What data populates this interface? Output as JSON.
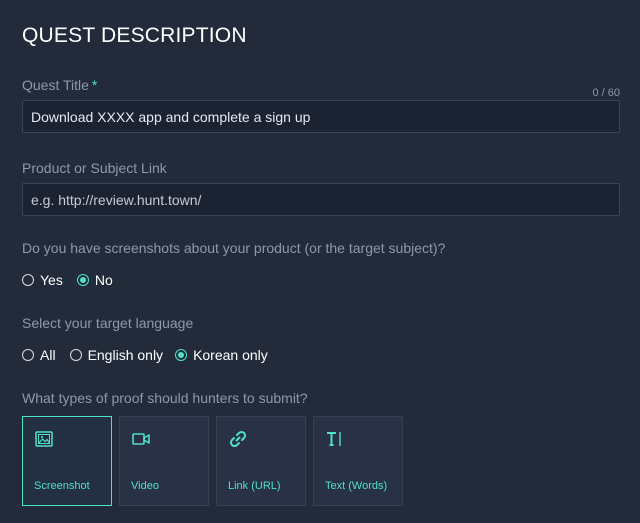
{
  "form": {
    "title": "QUEST DESCRIPTION",
    "quest_title": {
      "label": "Quest Title",
      "required_mark": "*",
      "counter": "0 / 60",
      "value": "Download XXXX app and complete a sign up"
    },
    "product_link": {
      "label": "Product or Subject Link",
      "placeholder": "e.g. http://review.hunt.town/"
    },
    "screenshots_question": {
      "label": "Do you have screenshots about your product (or the target subject)?",
      "options": [
        {
          "label": "Yes",
          "checked": false
        },
        {
          "label": "No",
          "checked": true
        }
      ]
    },
    "language": {
      "label": "Select your target language",
      "options": [
        {
          "label": "All",
          "checked": false
        },
        {
          "label": "English only",
          "checked": false
        },
        {
          "label": "Korean only",
          "checked": true
        }
      ]
    },
    "proof": {
      "label": "What types of proof should hunters to submit?",
      "options": [
        {
          "label": "Screenshot",
          "icon": "image-icon",
          "selected": true
        },
        {
          "label": "Video",
          "icon": "video-icon",
          "selected": false
        },
        {
          "label": "Link (URL)",
          "icon": "link-icon",
          "selected": false
        },
        {
          "label": "Text (Words)",
          "icon": "text-icon",
          "selected": false
        }
      ]
    }
  },
  "colors": {
    "background": "#232b3b",
    "accent": "#4fe0c8",
    "muted_text": "#8f98a8",
    "field_background": "#1b2231"
  }
}
